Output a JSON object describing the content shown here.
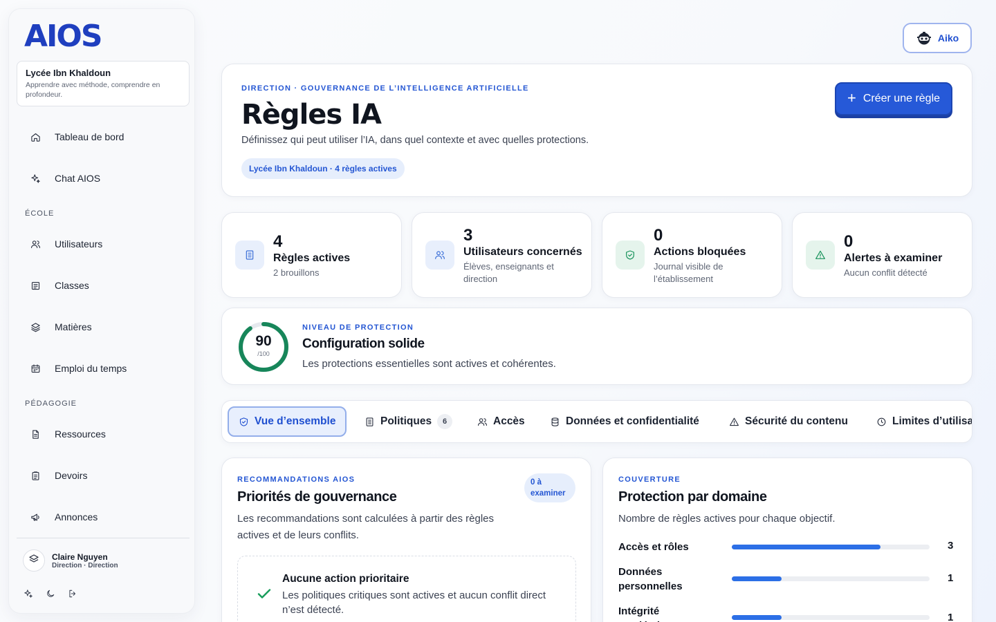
{
  "app": {
    "logo": "AIOS"
  },
  "school": {
    "name": "Lycée Ibn Khaldoun",
    "motto": "Apprendre avec méthode, comprendre en profondeur."
  },
  "sidebar": {
    "items": [
      {
        "label": "Tableau de bord",
        "icon": "home-icon"
      },
      {
        "label": "Chat AIOS",
        "icon": "sparkles-icon"
      }
    ],
    "section_ecole": "ÉCOLE",
    "ecole_items": [
      {
        "label": "Utilisateurs",
        "icon": "users-icon"
      },
      {
        "label": "Classes",
        "icon": "classes-icon"
      },
      {
        "label": "Matières",
        "icon": "layers-icon"
      },
      {
        "label": "Emploi du temps",
        "icon": "calendar-icon"
      }
    ],
    "section_pedagogie": "PÉDAGOGIE",
    "pedagogie_items": [
      {
        "label": "Ressources",
        "icon": "file-icon"
      },
      {
        "label": "Devoirs",
        "icon": "clipboard-icon"
      },
      {
        "label": "Annonces",
        "icon": "megaphone-icon"
      }
    ]
  },
  "user": {
    "name": "Claire Nguyen",
    "role": "Direction · Direction"
  },
  "top_user_chip": {
    "label": "Aiko"
  },
  "hero": {
    "eyebrow": "DIRECTION · GOUVERNANCE DE L’INTELLIGENCE ARTIFICIELLE",
    "title": "Règles IA",
    "description": "Définissez qui peut utiliser l’IA, dans quel contexte et avec quelles protections.",
    "pill": "Lycée Ibn Khaldoun · 4 règles actives",
    "create_button": "Créer une règle"
  },
  "stats": [
    {
      "value": "4",
      "label": "Règles actives",
      "sub": "2 brouillons",
      "icon": "document-icon",
      "color": "#3b6fd8",
      "bg": "#e8effc"
    },
    {
      "value": "3",
      "label": "Utilisateurs concernés",
      "sub": "Élèves, enseignants et direction",
      "icon": "users-icon",
      "color": "#3b6fd8",
      "bg": "#e8effc"
    },
    {
      "value": "0",
      "label": "Actions bloquées",
      "sub": "Journal visible de l’établissement",
      "icon": "shield-check-icon",
      "color": "#17925a",
      "bg": "#e5f4ec"
    },
    {
      "value": "0",
      "label": "Alertes à examiner",
      "sub": "Aucun conflit détecté",
      "icon": "warning-icon",
      "color": "#17925a",
      "bg": "#e5f4ec"
    }
  ],
  "protection": {
    "score": "90",
    "max": "/100",
    "score_fraction": 0.9,
    "eyebrow": "NIVEAU DE PROTECTION",
    "title": "Configuration solide",
    "subtitle": "Les protections essentielles sont actives et cohérentes.",
    "color": "#17865a"
  },
  "tabs": [
    {
      "label": "Vue d’ensemble",
      "icon": "shield-icon",
      "active": true
    },
    {
      "label": "Politiques",
      "icon": "document-icon",
      "badge": "6"
    },
    {
      "label": "Accès",
      "icon": "users-icon"
    },
    {
      "label": "Données et confidentialité",
      "icon": "database-icon"
    },
    {
      "label": "Sécurité du contenu",
      "icon": "warning-icon"
    },
    {
      "label": "Limites d’utilisa",
      "icon": "clock-icon"
    }
  ],
  "recommendations": {
    "eyebrow": "RECOMMANDATIONS AIOS",
    "title": "Priorités de gouvernance",
    "subtitle": "Les recommandations sont calculées à partir des règles actives et de leurs conflits.",
    "pill": "0 à examiner",
    "empty_title": "Aucune action prioritaire",
    "empty_sub": "Les politiques critiques sont actives et aucun conflit direct n’est détecté."
  },
  "coverage": {
    "eyebrow": "COUVERTURE",
    "title": "Protection par domaine",
    "subtitle": "Nombre de règles actives pour chaque objectif.",
    "rows": [
      {
        "label": "Accès et rôles",
        "value": "3",
        "fraction": 0.75
      },
      {
        "label": "Données personnelles",
        "value": "1",
        "fraction": 0.25
      },
      {
        "label": "Intégrité académique",
        "value": "1",
        "fraction": 0.25
      }
    ],
    "bar_color": "#2c6fe6"
  }
}
